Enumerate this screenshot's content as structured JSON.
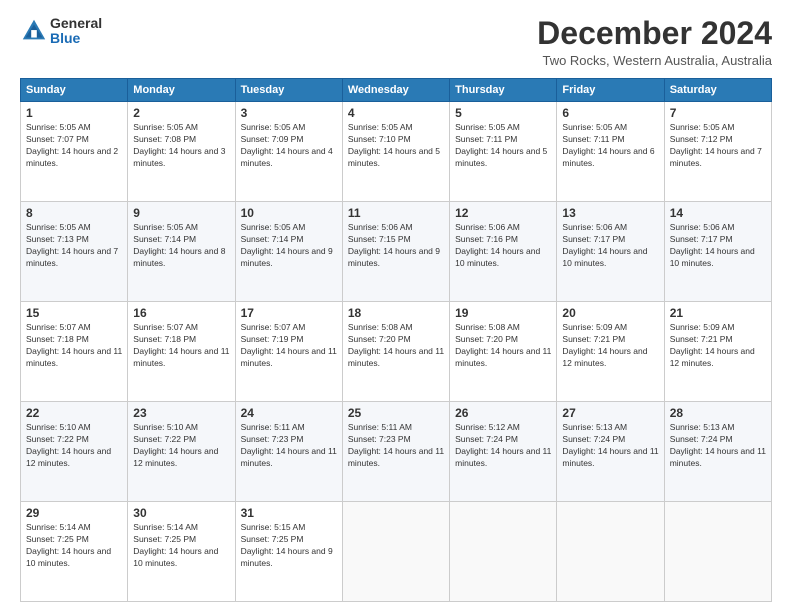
{
  "logo": {
    "general": "General",
    "blue": "Blue"
  },
  "title": "December 2024",
  "subtitle": "Two Rocks, Western Australia, Australia",
  "days_header": [
    "Sunday",
    "Monday",
    "Tuesday",
    "Wednesday",
    "Thursday",
    "Friday",
    "Saturday"
  ],
  "weeks": [
    [
      {
        "day": "1",
        "sunrise": "5:05 AM",
        "sunset": "7:07 PM",
        "daylight": "14 hours and 2 minutes."
      },
      {
        "day": "2",
        "sunrise": "5:05 AM",
        "sunset": "7:08 PM",
        "daylight": "14 hours and 3 minutes."
      },
      {
        "day": "3",
        "sunrise": "5:05 AM",
        "sunset": "7:09 PM",
        "daylight": "14 hours and 4 minutes."
      },
      {
        "day": "4",
        "sunrise": "5:05 AM",
        "sunset": "7:10 PM",
        "daylight": "14 hours and 5 minutes."
      },
      {
        "day": "5",
        "sunrise": "5:05 AM",
        "sunset": "7:11 PM",
        "daylight": "14 hours and 5 minutes."
      },
      {
        "day": "6",
        "sunrise": "5:05 AM",
        "sunset": "7:11 PM",
        "daylight": "14 hours and 6 minutes."
      },
      {
        "day": "7",
        "sunrise": "5:05 AM",
        "sunset": "7:12 PM",
        "daylight": "14 hours and 7 minutes."
      }
    ],
    [
      {
        "day": "8",
        "sunrise": "5:05 AM",
        "sunset": "7:13 PM",
        "daylight": "14 hours and 7 minutes."
      },
      {
        "day": "9",
        "sunrise": "5:05 AM",
        "sunset": "7:14 PM",
        "daylight": "14 hours and 8 minutes."
      },
      {
        "day": "10",
        "sunrise": "5:05 AM",
        "sunset": "7:14 PM",
        "daylight": "14 hours and 9 minutes."
      },
      {
        "day": "11",
        "sunrise": "5:06 AM",
        "sunset": "7:15 PM",
        "daylight": "14 hours and 9 minutes."
      },
      {
        "day": "12",
        "sunrise": "5:06 AM",
        "sunset": "7:16 PM",
        "daylight": "14 hours and 10 minutes."
      },
      {
        "day": "13",
        "sunrise": "5:06 AM",
        "sunset": "7:17 PM",
        "daylight": "14 hours and 10 minutes."
      },
      {
        "day": "14",
        "sunrise": "5:06 AM",
        "sunset": "7:17 PM",
        "daylight": "14 hours and 10 minutes."
      }
    ],
    [
      {
        "day": "15",
        "sunrise": "5:07 AM",
        "sunset": "7:18 PM",
        "daylight": "14 hours and 11 minutes."
      },
      {
        "day": "16",
        "sunrise": "5:07 AM",
        "sunset": "7:18 PM",
        "daylight": "14 hours and 11 minutes."
      },
      {
        "day": "17",
        "sunrise": "5:07 AM",
        "sunset": "7:19 PM",
        "daylight": "14 hours and 11 minutes."
      },
      {
        "day": "18",
        "sunrise": "5:08 AM",
        "sunset": "7:20 PM",
        "daylight": "14 hours and 11 minutes."
      },
      {
        "day": "19",
        "sunrise": "5:08 AM",
        "sunset": "7:20 PM",
        "daylight": "14 hours and 11 minutes."
      },
      {
        "day": "20",
        "sunrise": "5:09 AM",
        "sunset": "7:21 PM",
        "daylight": "14 hours and 12 minutes."
      },
      {
        "day": "21",
        "sunrise": "5:09 AM",
        "sunset": "7:21 PM",
        "daylight": "14 hours and 12 minutes."
      }
    ],
    [
      {
        "day": "22",
        "sunrise": "5:10 AM",
        "sunset": "7:22 PM",
        "daylight": "14 hours and 12 minutes."
      },
      {
        "day": "23",
        "sunrise": "5:10 AM",
        "sunset": "7:22 PM",
        "daylight": "14 hours and 12 minutes."
      },
      {
        "day": "24",
        "sunrise": "5:11 AM",
        "sunset": "7:23 PM",
        "daylight": "14 hours and 11 minutes."
      },
      {
        "day": "25",
        "sunrise": "5:11 AM",
        "sunset": "7:23 PM",
        "daylight": "14 hours and 11 minutes."
      },
      {
        "day": "26",
        "sunrise": "5:12 AM",
        "sunset": "7:24 PM",
        "daylight": "14 hours and 11 minutes."
      },
      {
        "day": "27",
        "sunrise": "5:13 AM",
        "sunset": "7:24 PM",
        "daylight": "14 hours and 11 minutes."
      },
      {
        "day": "28",
        "sunrise": "5:13 AM",
        "sunset": "7:24 PM",
        "daylight": "14 hours and 11 minutes."
      }
    ],
    [
      {
        "day": "29",
        "sunrise": "5:14 AM",
        "sunset": "7:25 PM",
        "daylight": "14 hours and 10 minutes."
      },
      {
        "day": "30",
        "sunrise": "5:14 AM",
        "sunset": "7:25 PM",
        "daylight": "14 hours and 10 minutes."
      },
      {
        "day": "31",
        "sunrise": "5:15 AM",
        "sunset": "7:25 PM",
        "daylight": "14 hours and 9 minutes."
      },
      null,
      null,
      null,
      null
    ]
  ]
}
